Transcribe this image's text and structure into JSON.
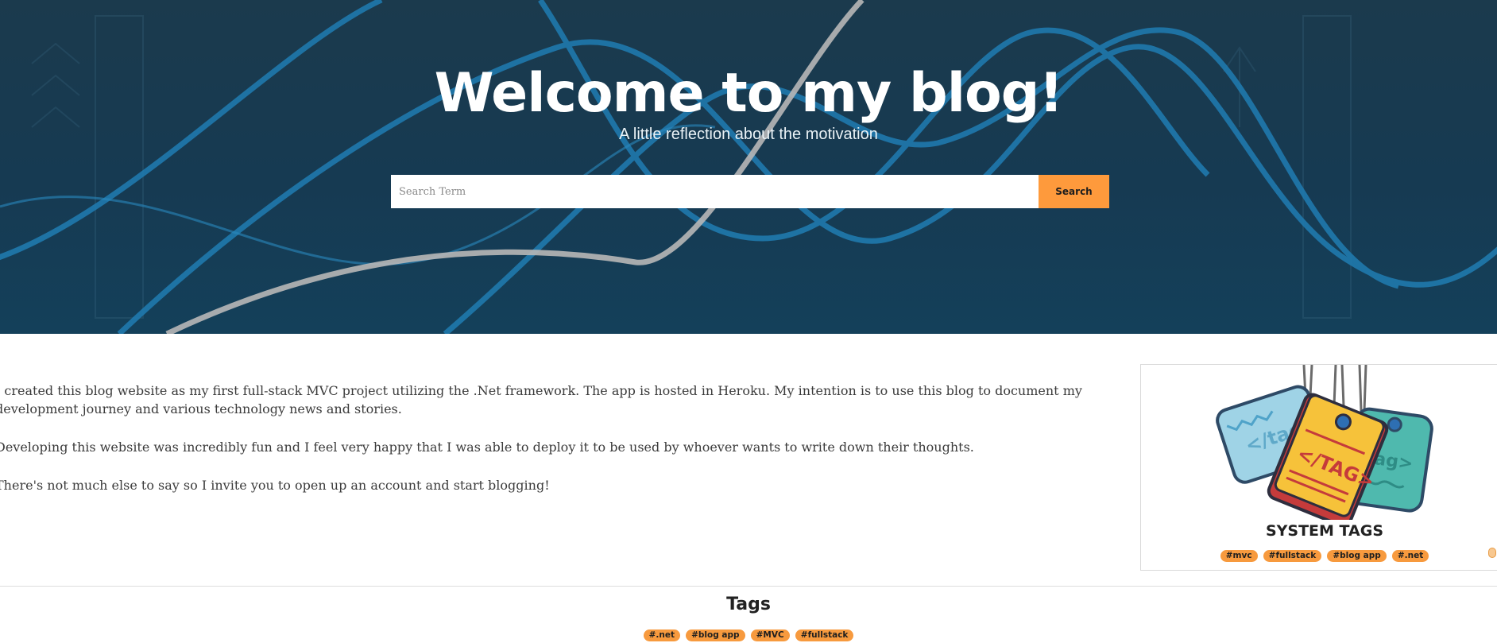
{
  "hero": {
    "title": "Welcome to my blog!",
    "subtitle": "A little reflection about the motivation"
  },
  "search": {
    "placeholder": "Search Term",
    "value": "",
    "button_label": "Search"
  },
  "intro": {
    "paragraphs": [
      "I created this blog website as my first full-stack MVC project utilizing the .Net framework. The app is hosted in Heroku. My intention is to use this blog to document my development journey and various technology news and stories.",
      "Developing this website was incredibly fun and I feel very happy that I was able to deploy it to be used by whoever wants to write down their thoughts.",
      "There's not much else to say so I invite you to open up an account and start blogging!"
    ]
  },
  "system_tags": {
    "title": "SYSTEM TAGS",
    "image_text": [
      "</tag>",
      "</TAG>",
      "tag>"
    ],
    "tags": [
      "#mvc",
      "#fullstack",
      "#blog app",
      "#.net"
    ]
  },
  "tags_section": {
    "title": "Tags",
    "tags": [
      "#.net",
      "#blog app",
      "#MVC",
      "#fullstack"
    ]
  },
  "colors": {
    "accent": "#fe9a3c",
    "hero_bg": "#163a52"
  }
}
